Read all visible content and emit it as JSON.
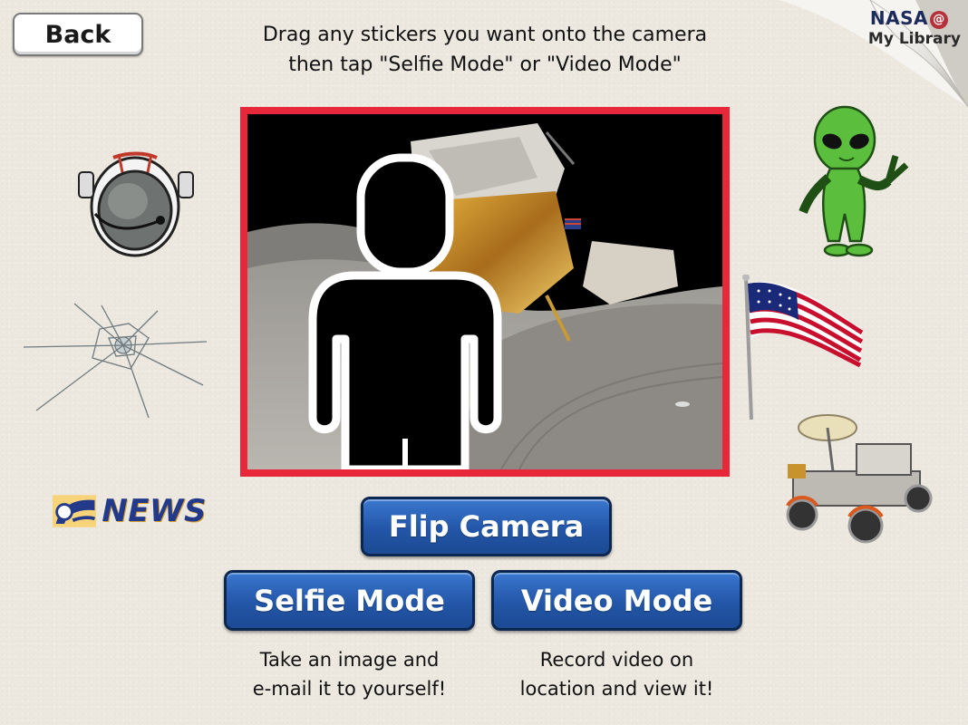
{
  "header": {
    "back_label": "Back",
    "instruction_line1": "Drag any stickers you want onto the camera",
    "instruction_line2": "then tap \"Selfie Mode\" or \"Video Mode\""
  },
  "branding": {
    "nasa": "NASA",
    "at": "@",
    "my_library": "My Library"
  },
  "buttons": {
    "flip": "Flip Camera",
    "selfie": "Selfie Mode",
    "video": "Video Mode"
  },
  "captions": {
    "selfie_line1": "Take an image and",
    "selfie_line2": "e-mail it to yourself!",
    "video_line1": "Record video on",
    "video_line2": "location and view it!"
  },
  "stickers": {
    "news_label": "NEWS",
    "items": [
      "astronaut-helmet",
      "alien",
      "cracked-glass",
      "american-flag",
      "news-logo",
      "lunar-rover"
    ]
  },
  "colors": {
    "camera_border": "#e8283a",
    "button_blue": "#2356a8",
    "background": "#ece8df"
  }
}
